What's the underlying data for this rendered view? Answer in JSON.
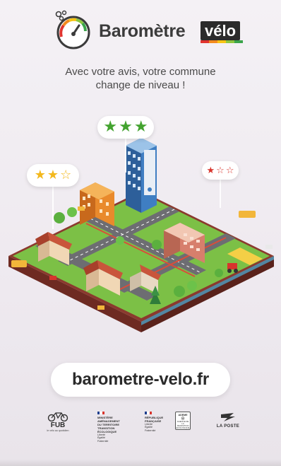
{
  "header": {
    "logo_word": "Baromètre",
    "logo_badge": "vélo",
    "colors": {
      "red": "#e0342f",
      "orange": "#f28a1e",
      "yellow": "#f7c414",
      "light_green": "#8cc63f",
      "green": "#3aa44a"
    }
  },
  "tagline": {
    "line1": "Avec votre avis, votre commune",
    "line2": "change de niveau !"
  },
  "ratings": [
    {
      "filled": 2,
      "max": 3,
      "color": "#f3b81d"
    },
    {
      "filled": 3,
      "max": 3,
      "color": "#43a32f"
    },
    {
      "filled": 1,
      "max": 3,
      "color": "#d8352d"
    }
  ],
  "icons": {
    "filled_star": "star-filled-icon",
    "empty_star": "star-outline-icon"
  },
  "url": "barometre-velo.fr",
  "partners": {
    "fub": {
      "name": "FUB",
      "subtitle": "le vélo au quotidien"
    },
    "ministere": {
      "lines": [
        "MINISTÈRE",
        "AMÉNAGEMENT",
        "DU TERRITOIRE",
        "TRANSITION",
        "ÉCOLOGIQUE"
      ],
      "motto": [
        "Liberté",
        "Égalité",
        "Fraternité"
      ]
    },
    "republique": {
      "lines": [
        "RÉPUBLIQUE",
        "FRANÇAISE"
      ],
      "motto": [
        "Liberté",
        "Égalité",
        "Fraternité"
      ]
    },
    "ademe": {
      "name": "ADEME",
      "subtitle": "AGENCE DE LA TRANSITION ÉCOLOGIQUE"
    },
    "laposte": {
      "name": "LA POSTE"
    }
  }
}
